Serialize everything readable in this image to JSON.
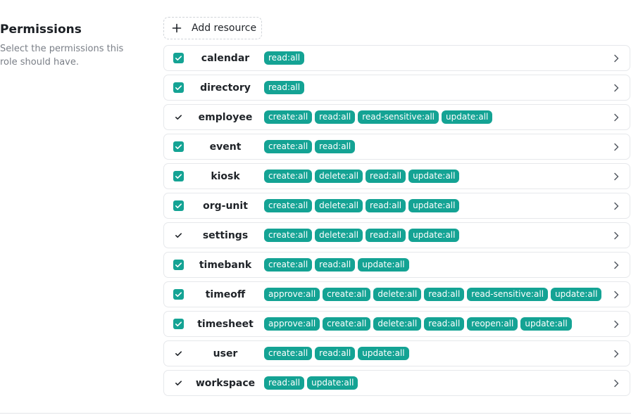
{
  "section": {
    "title": "Permissions",
    "description": "Select the permissions this role should have."
  },
  "add_resource": {
    "label": "Add resource",
    "icon": "plus-icon"
  },
  "accent_color": "#14a394",
  "resources": [
    {
      "name": "calendar",
      "checked": true,
      "style": "filled",
      "permissions": [
        "read:all"
      ]
    },
    {
      "name": "directory",
      "checked": true,
      "style": "filled",
      "permissions": [
        "read:all"
      ]
    },
    {
      "name": "employee",
      "checked": true,
      "style": "plain",
      "permissions": [
        "create:all",
        "read:all",
        "read-sensitive:all",
        "update:all"
      ]
    },
    {
      "name": "event",
      "checked": true,
      "style": "filled",
      "permissions": [
        "create:all",
        "read:all"
      ]
    },
    {
      "name": "kiosk",
      "checked": true,
      "style": "filled",
      "permissions": [
        "create:all",
        "delete:all",
        "read:all",
        "update:all"
      ]
    },
    {
      "name": "org-unit",
      "checked": true,
      "style": "filled",
      "permissions": [
        "create:all",
        "delete:all",
        "read:all",
        "update:all"
      ]
    },
    {
      "name": "settings",
      "checked": true,
      "style": "plain",
      "permissions": [
        "create:all",
        "delete:all",
        "read:all",
        "update:all"
      ]
    },
    {
      "name": "timebank",
      "checked": true,
      "style": "filled",
      "permissions": [
        "create:all",
        "read:all",
        "update:all"
      ]
    },
    {
      "name": "timeoff",
      "checked": true,
      "style": "filled",
      "permissions": [
        "approve:all",
        "create:all",
        "delete:all",
        "read:all",
        "read-sensitive:all",
        "update:all"
      ]
    },
    {
      "name": "timesheet",
      "checked": true,
      "style": "filled",
      "permissions": [
        "approve:all",
        "create:all",
        "delete:all",
        "read:all",
        "reopen:all",
        "update:all"
      ]
    },
    {
      "name": "user",
      "checked": true,
      "style": "plain",
      "permissions": [
        "create:all",
        "read:all",
        "update:all"
      ]
    },
    {
      "name": "workspace",
      "checked": true,
      "style": "plain",
      "permissions": [
        "read:all",
        "update:all"
      ]
    }
  ]
}
